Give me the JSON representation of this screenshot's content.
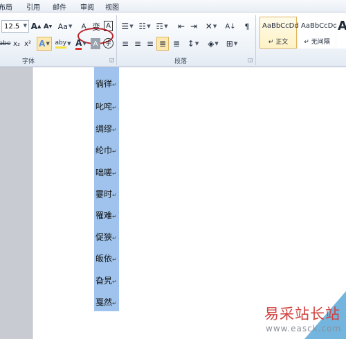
{
  "menu": [
    "布局",
    "引用",
    "邮件",
    "审阅",
    "视图"
  ],
  "font": {
    "size": "12.5",
    "grow": "A",
    "shrink": "A",
    "case": "Aa",
    "clear": "A",
    "wen": "变",
    "border": "A",
    "strike": "abe",
    "subscript": "x₂",
    "superscript": "x²",
    "effects": "A",
    "highlight": "aby",
    "color": "A",
    "shade": "A",
    "enclose": "字",
    "group_label": "字体"
  },
  "paragraph": {
    "group_label": "段落",
    "sort": "A↓"
  },
  "styles": [
    {
      "sample": "AaBbCcDd",
      "name": "↵ 正文"
    },
    {
      "sample": "AaBbCcDd",
      "name": "↵ 无间隔"
    },
    {
      "sample": "A",
      "name": ""
    }
  ],
  "document_lines": [
    "徜徉",
    "叱咤",
    "绸缪",
    "纶巾",
    "咄嗟",
    "霎时",
    "罹难",
    "促狭",
    "皈依",
    "旮旯",
    "戛然"
  ],
  "paragraph_mark": "↵",
  "watermark": {
    "text": "易采站长站",
    "url": "www.easck.com"
  },
  "colors": {
    "selection": "#9fc3ec",
    "circle": "#b8252b",
    "font_color": "#d9302c",
    "highlight": "#f4e23a"
  }
}
